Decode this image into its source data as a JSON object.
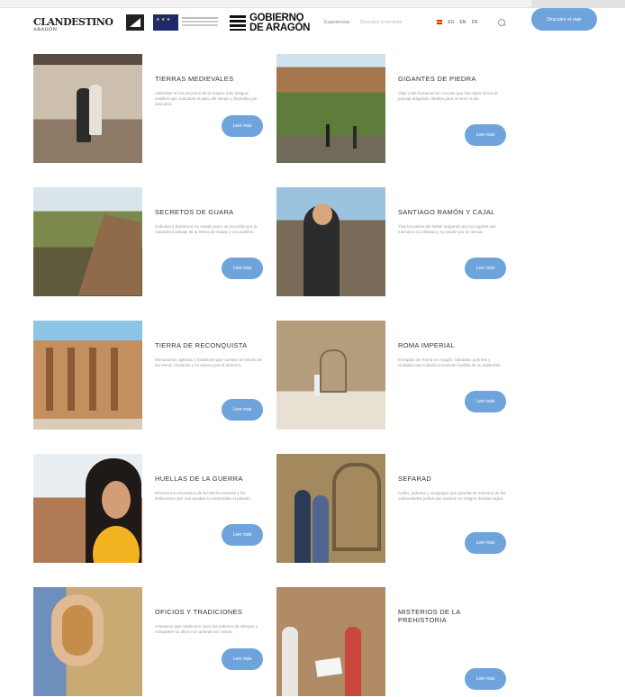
{
  "header": {
    "logo_main": "CLANDESTINO",
    "logo_sub": "ARAGÓN",
    "gobierno_line1": "GOBIERNO",
    "gobierno_line2": "DE ARAGÓN",
    "nav": [
      "Experiencias",
      "Descubre el territorio"
    ],
    "languages": [
      "ES",
      "EN",
      "FR"
    ],
    "cta_label": "Descubre el viaje"
  },
  "cards": [
    {
      "title": "TIERRAS MEDIEVALES",
      "desc": "Adéntrate en los secretos de la Aragón más antigua: castillos que custodian el paso del tiempo y leyendas por descubrir.",
      "button": "Leer más"
    },
    {
      "title": "GIGANTES DE PIEDRA",
      "desc": "Viaje a las formaciones rocosas que han dado forma al paisaje aragonés, ideales para recorrer a pie.",
      "button": "Leer más"
    },
    {
      "title": "SECRETOS DE GUARA",
      "desc": "Cañones y barrancos en estado puro: un recorrido por la naturaleza salvaje de la Sierra de Guara y sus pueblos.",
      "button": "Leer más"
    },
    {
      "title": "SANTIAGO RAMÓN Y CAJAL",
      "desc": "Tras los pasos del Nobel aragonés por los lugares que marcaron su infancia y su pasión por la ciencia.",
      "button": "Leer más"
    },
    {
      "title": "TIERRA DE RECONQUISTA",
      "desc": "Monasterios, iglesias y fortalezas que cuentan la historia de los reinos cristianos y su avance por el territorio.",
      "button": "Leer más"
    },
    {
      "title": "ROMA IMPERIAL",
      "desc": "El legado de Roma en Aragón: calzadas, puentes y ciudades que todavía conservan huellas de su esplendor.",
      "button": "Leer más"
    },
    {
      "title": "HUELLAS DE LA GUERRA",
      "desc": "Recorre los escenarios de la historia reciente y los testimonios que nos ayudan a comprender el pasado.",
      "button": "Leer más"
    },
    {
      "title": "SEFARAD",
      "desc": "Calles, juderías y sinagogas que guardan la memoria de las comunidades judías que vivieron en Aragón durante siglos.",
      "button": "Leer más"
    },
    {
      "title": "OFICIOS Y TRADICIONES",
      "desc": "Artesanos que mantienen vivos los saberes de siempre y comparten su oficio con quienes los visitan.",
      "button": "Leer más"
    },
    {
      "title": "MISTERIOS DE LA PREHISTORIA",
      "desc": "",
      "button": "Leer más"
    }
  ]
}
